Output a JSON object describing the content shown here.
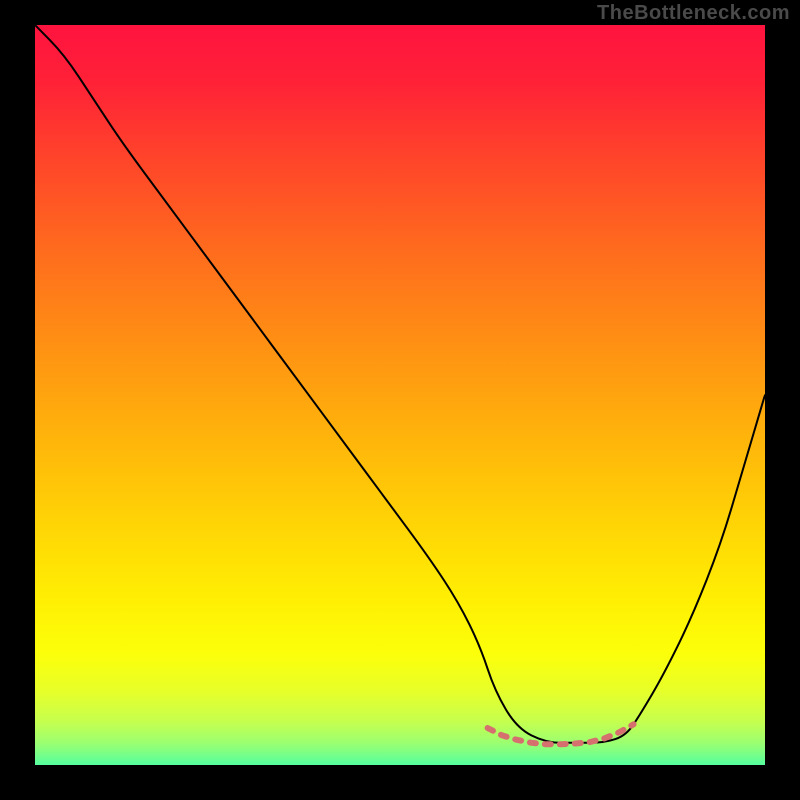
{
  "watermark": "TheBottleneck.com",
  "chart_data": {
    "type": "line",
    "title": "",
    "xlabel": "",
    "ylabel": "",
    "xlim": [
      0,
      100
    ],
    "ylim": [
      0,
      100
    ],
    "gradient": {
      "stops": [
        {
          "offset": 0.0,
          "color": "#ff133f"
        },
        {
          "offset": 0.08,
          "color": "#ff2237"
        },
        {
          "offset": 0.18,
          "color": "#ff442a"
        },
        {
          "offset": 0.3,
          "color": "#ff6a1e"
        },
        {
          "offset": 0.42,
          "color": "#ff8d14"
        },
        {
          "offset": 0.55,
          "color": "#ffb20b"
        },
        {
          "offset": 0.68,
          "color": "#ffd605"
        },
        {
          "offset": 0.78,
          "color": "#fff003"
        },
        {
          "offset": 0.85,
          "color": "#fcff0a"
        },
        {
          "offset": 0.9,
          "color": "#e7ff29"
        },
        {
          "offset": 0.94,
          "color": "#c7ff4d"
        },
        {
          "offset": 0.97,
          "color": "#9cff70"
        },
        {
          "offset": 1.0,
          "color": "#55ff9f"
        }
      ]
    },
    "series": [
      {
        "name": "bottleneck-curve",
        "color": "#000000",
        "width": 2,
        "x": [
          0,
          4,
          8,
          12,
          18,
          24,
          30,
          36,
          42,
          48,
          54,
          58,
          61,
          63,
          66,
          70,
          74,
          78,
          81,
          83,
          86,
          90,
          94,
          97,
          100
        ],
        "y": [
          100,
          96,
          90,
          84,
          76,
          68,
          60,
          52,
          44,
          36,
          28,
          22,
          16,
          10,
          5,
          3,
          3,
          3,
          4,
          7,
          12,
          20,
          30,
          40,
          50
        ]
      }
    ],
    "highlight": {
      "name": "optimal-range-marker",
      "color": "#d6706f",
      "width": 6,
      "x": [
        62,
        64,
        66,
        68,
        70,
        72,
        74,
        76,
        78,
        80,
        82
      ],
      "y": [
        5,
        4.0,
        3.4,
        3.0,
        2.8,
        2.8,
        2.9,
        3.1,
        3.6,
        4.4,
        5.5
      ]
    }
  }
}
